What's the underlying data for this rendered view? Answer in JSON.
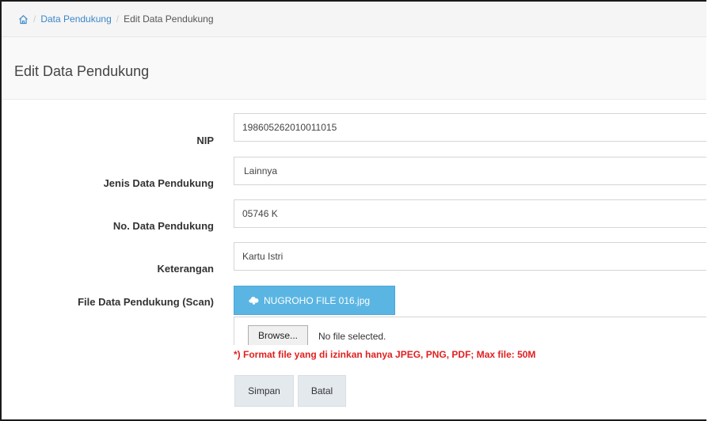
{
  "breadcrumb": {
    "home_icon": "home-icon",
    "separator": "/",
    "items": [
      "Data Pendukung",
      "Edit Data Pendukung"
    ]
  },
  "page": {
    "title": "Edit Data Pendukung"
  },
  "form": {
    "nip": {
      "label": "NIP",
      "value": "198605262010011015"
    },
    "jenis": {
      "label": "Jenis Data Pendukung",
      "value": "Lainnya"
    },
    "nomor": {
      "label": "No. Data Pendukung",
      "value": "05746 K"
    },
    "keterangan": {
      "label": "Keterangan",
      "value": "Kartu Istri"
    },
    "file": {
      "label": "File Data Pendukung (Scan)",
      "current_file": "NUGROHO FILE 016.jpg",
      "current_file_icon": "cloud-download-icon",
      "browse_label": "Browse...",
      "no_file_text": "No file selected.",
      "note": "*) Format file yang di izinkan hanya JPEG, PNG, PDF; Max file: 50M"
    }
  },
  "actions": {
    "save_label": "Simpan",
    "cancel_label": "Batal"
  },
  "colors": {
    "link": "#3a87c8",
    "file_button": "#5ab5e3",
    "note": "#e02020"
  }
}
